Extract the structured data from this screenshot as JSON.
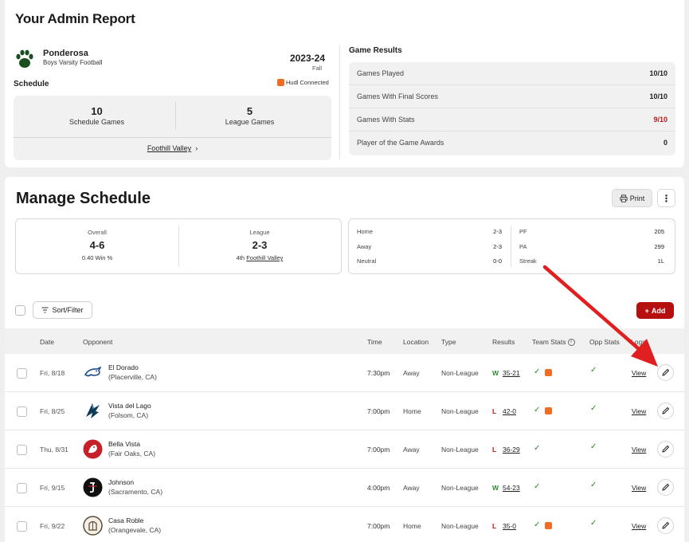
{
  "admin_report": {
    "title": "Your Admin Report",
    "school": {
      "name": "Ponderosa",
      "team": "Boys Varsity Football"
    },
    "season": {
      "year": "2023-24",
      "term": "Fall"
    },
    "schedule_label": "Schedule",
    "hudl_badge": "Hudl Connected",
    "schedule_stats": [
      {
        "value": "10",
        "label": "Schedule Games"
      },
      {
        "value": "5",
        "label": "League Games"
      }
    ],
    "conference_link": "Foothill Valley",
    "game_results": {
      "title": "Game Results",
      "rows": [
        {
          "label": "Games Played",
          "value": "10/10"
        },
        {
          "label": "Games With Final Scores",
          "value": "10/10"
        },
        {
          "label": "Games With Stats",
          "value": "9/10"
        },
        {
          "label": "Player of the Game Awards",
          "value": "0"
        }
      ]
    }
  },
  "manage_schedule": {
    "title": "Manage Schedule",
    "print_label": "Print",
    "record": {
      "overall": {
        "caption": "Overall",
        "value": "4-6",
        "detail": "0.40 Win %"
      },
      "league": {
        "caption": "League",
        "value": "2-3",
        "rank": "4th",
        "conference": "Foothill Valley"
      }
    },
    "splits_left": [
      {
        "label": "Home",
        "value": "2-3"
      },
      {
        "label": "Away",
        "value": "2-3"
      },
      {
        "label": "Neutral",
        "value": "0-0"
      }
    ],
    "splits_right": [
      {
        "label": "PF",
        "value": "205"
      },
      {
        "label": "PA",
        "value": "299"
      },
      {
        "label": "Streak",
        "value": "1L"
      }
    ],
    "sort_filter_label": "Sort/Filter",
    "add_label": "Add",
    "columns": {
      "date": "Date",
      "opponent": "Opponent",
      "time": "Time",
      "location": "Location",
      "type": "Type",
      "results": "Results",
      "team_stats": "Team Stats",
      "opp_stats": "Opp Stats",
      "logs": "Logs"
    },
    "games": [
      {
        "date": "Fri, 8/18",
        "opponent": "El Dorado",
        "city": "(Placerville, CA)",
        "time": "7:30pm",
        "location": "Away",
        "type": "Non-League",
        "outcome": "W",
        "score": "35-21",
        "view": "View",
        "logo_color": "#1f4e8c"
      },
      {
        "date": "Fri, 8/25",
        "opponent": "Vista del Lago",
        "city": "(Folsom, CA)",
        "time": "7:00pm",
        "location": "Home",
        "type": "Non-League",
        "outcome": "L",
        "score": "42-0",
        "view": "View",
        "logo_color": "#0d3b57"
      },
      {
        "date": "Thu, 8/31",
        "opponent": "Bella Vista",
        "city": "(Fair Oaks, CA)",
        "time": "7:00pm",
        "location": "Away",
        "type": "Non-League",
        "outcome": "L",
        "score": "36-29",
        "view": "View",
        "logo_color": "#c8202a"
      },
      {
        "date": "Fri, 9/15",
        "opponent": "Johnson",
        "city": "(Sacramento, CA)",
        "time": "4:00pm",
        "location": "Away",
        "type": "Non-League",
        "outcome": "W",
        "score": "54-23",
        "view": "View",
        "logo_color": "#111111"
      },
      {
        "date": "Fri, 9/22",
        "opponent": "Casa Roble",
        "city": "(Orangevale, CA)",
        "time": "7:00pm",
        "location": "Home",
        "type": "Non-League",
        "outcome": "L",
        "score": "35-0",
        "view": "View",
        "logo_color": "#5a4a3a"
      }
    ]
  },
  "colors": {
    "brand_red": "#b5100f",
    "win_green": "#2a8a2a",
    "loss_red": "#b81b1b",
    "hudl_orange": "#f26b22",
    "annotation_arrow": "#e02020"
  }
}
